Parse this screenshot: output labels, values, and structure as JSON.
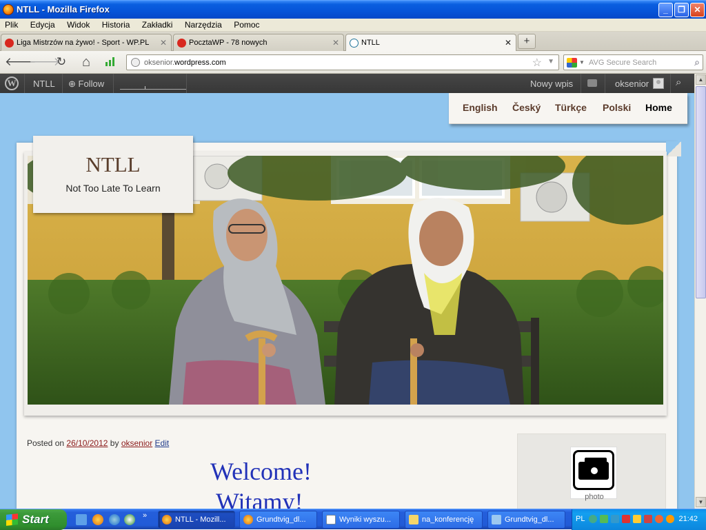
{
  "window": {
    "title": "NTLL - Mozilla Firefox",
    "buttons": {
      "minimize": "_",
      "maximize": "❐",
      "close": "✕"
    }
  },
  "menu": [
    "Plik",
    "Edycja",
    "Widok",
    "Historia",
    "Zakładki",
    "Narzędzia",
    "Pomoc"
  ],
  "tabs": [
    {
      "label": "Liga Mistrzów na żywo! - Sport - WP.PL",
      "icon": "wp-heart-icon",
      "active": false
    },
    {
      "label": "PocztaWP - 78 nowych",
      "icon": "wp-heart-icon",
      "active": false
    },
    {
      "label": "NTLL",
      "icon": "wordpress-icon",
      "active": true
    }
  ],
  "newtab_label": "+",
  "nav": {
    "back": "🡐",
    "forward": "🡒",
    "reload": "↻",
    "home": "⌂",
    "url_host_prefix": "oksenior.",
    "url_domain": "wordpress.com",
    "search_placeholder": "AVG Secure Search"
  },
  "wpbar": {
    "logo": "W",
    "site": "NTLL",
    "follow": "Follow",
    "new_post": "Nowy wpis",
    "user": "oksenior"
  },
  "top_menu": [
    "English",
    "Český",
    "Türkçe",
    "Polski",
    "Home"
  ],
  "site": {
    "title": "NTLL",
    "tagline": "Not Too Late To Learn"
  },
  "post": {
    "posted_on": "Posted on",
    "date": "26/10/2012",
    "by": "by",
    "author": "oksenior",
    "edit": "Edit",
    "title_line1": "Welcome!",
    "title_line2": "Witamy!"
  },
  "widget": {
    "caption": "photo"
  },
  "taskbar": {
    "start": "Start",
    "more": "»",
    "buttons": [
      {
        "label": "NTLL - Mozill...",
        "active": true
      },
      {
        "label": "Grundtvig_dl...",
        "active": false
      },
      {
        "label": "Wyniki wyszu...",
        "active": false
      },
      {
        "label": "na_konferencję",
        "active": false
      },
      {
        "label": "Grundtvig_dl...",
        "active": false
      }
    ],
    "lang": "PL",
    "clock": "21:42"
  }
}
